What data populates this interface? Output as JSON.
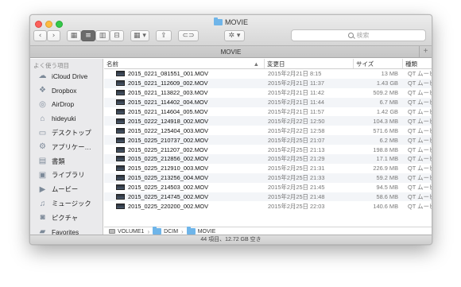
{
  "window": {
    "title": "MOVIE"
  },
  "toolbar": {
    "back": "‹",
    "forward": "›",
    "view_icon": "▦",
    "view_list": "≡",
    "view_columns": "▥",
    "view_coverflow": "⊟",
    "arrange": "▦ ▾",
    "share": "⇪",
    "tag": "⊂⊃",
    "action": "✲ ▾",
    "search_placeholder": "検索"
  },
  "tab": {
    "label": "MOVIE",
    "plus": "+"
  },
  "sidebar": {
    "heading": "よく使う項目",
    "items": [
      {
        "label": "iCloud Drive",
        "icon": "☁"
      },
      {
        "label": "Dropbox",
        "icon": "❖"
      },
      {
        "label": "AirDrop",
        "icon": "◎"
      },
      {
        "label": "hideyuki",
        "icon": "⌂"
      },
      {
        "label": "デスクトップ",
        "icon": "▭"
      },
      {
        "label": "アプリケー…",
        "icon": "⚙"
      },
      {
        "label": "書類",
        "icon": "▤"
      },
      {
        "label": "ライブラリ",
        "icon": "▣"
      },
      {
        "label": "ムービー",
        "icon": "▶"
      },
      {
        "label": "ミュージック",
        "icon": "♫"
      },
      {
        "label": "ピクチャ",
        "icon": "◙"
      },
      {
        "label": "Favorites",
        "icon": "▰"
      }
    ]
  },
  "columns": {
    "name": "名前",
    "date": "変更日",
    "size": "サイズ",
    "kind": "種類",
    "sort_arrow": "▲"
  },
  "files": [
    {
      "name": "2015_0221_081551_001.MOV",
      "date": "2015年2月21日 8:15",
      "size": "13 MB",
      "kind": "QT ムービー"
    },
    {
      "name": "2015_0221_112609_002.MOV",
      "date": "2015年2月21日 11:37",
      "size": "1.43 GB",
      "kind": "QT ムービー"
    },
    {
      "name": "2015_0221_113822_003.MOV",
      "date": "2015年2月21日 11:42",
      "size": "509.2 MB",
      "kind": "QT ムービー"
    },
    {
      "name": "2015_0221_114402_004.MOV",
      "date": "2015年2月21日 11:44",
      "size": "6.7 MB",
      "kind": "QT ムービー"
    },
    {
      "name": "2015_0221_114604_005.MOV",
      "date": "2015年2月21日 11:57",
      "size": "1.42 GB",
      "kind": "QT ムービー"
    },
    {
      "name": "2015_0222_124918_002.MOV",
      "date": "2015年2月22日 12:50",
      "size": "104.3 MB",
      "kind": "QT ムービー"
    },
    {
      "name": "2015_0222_125404_003.MOV",
      "date": "2015年2月22日 12:58",
      "size": "571.6 MB",
      "kind": "QT ムービー"
    },
    {
      "name": "2015_0225_210737_002.MOV",
      "date": "2015年2月25日 21:07",
      "size": "6.2 MB",
      "kind": "QT ムービー"
    },
    {
      "name": "2015_0225_211207_002.MOV",
      "date": "2015年2月25日 21:13",
      "size": "198.8 MB",
      "kind": "QT ムービー"
    },
    {
      "name": "2015_0225_212856_002.MOV",
      "date": "2015年2月25日 21:29",
      "size": "17.1 MB",
      "kind": "QT ムービー"
    },
    {
      "name": "2015_0225_212910_003.MOV",
      "date": "2015年2月25日 21:31",
      "size": "226.9 MB",
      "kind": "QT ムービー"
    },
    {
      "name": "2015_0225_213256_004.MOV",
      "date": "2015年2月25日 21:33",
      "size": "59.2 MB",
      "kind": "QT ムービー"
    },
    {
      "name": "2015_0225_214503_002.MOV",
      "date": "2015年2月25日 21:45",
      "size": "94.5 MB",
      "kind": "QT ムービー"
    },
    {
      "name": "2015_0225_214745_002.MOV",
      "date": "2015年2月25日 21:48",
      "size": "58.6 MB",
      "kind": "QT ムービー"
    },
    {
      "name": "2015_0225_220200_002.MOV",
      "date": "2015年2月25日 22:03",
      "size": "140.6 MB",
      "kind": "QT ムービー"
    }
  ],
  "pathbar": {
    "volume": "VOLUME1",
    "dcim": "DCIM",
    "movie": "MOVIE",
    "sep": "›"
  },
  "status": "44 項目、12.72 GB 空き"
}
